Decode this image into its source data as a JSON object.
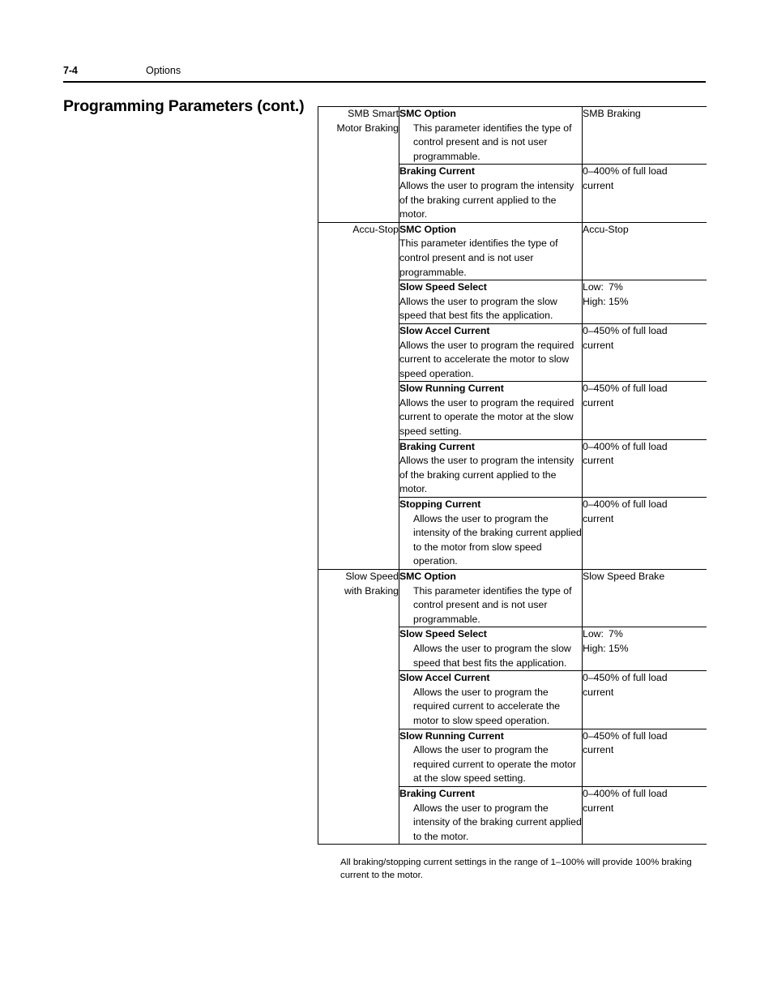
{
  "header": {
    "page_number": "7-4",
    "section": "Options"
  },
  "title": "Programming Parameters (cont.)",
  "footnote": "All braking/stopping current settings in the range of 1–100% will provide 100% braking current to the motor.",
  "table": {
    "groups": [
      {
        "label_lines": [
          "SMB Smart",
          "Motor Braking"
        ],
        "rows": [
          {
            "name": "SMC Option",
            "body": "This parameter identifies the type of control present and is not user programmable.",
            "indented": true,
            "value_lines": [
              "SMB Braking"
            ]
          },
          {
            "name": "Braking Current",
            "body": "Allows the user to program the intensity of the braking current applied to the motor.",
            "indented": false,
            "value_lines": [
              "0–400% of full load",
              "current"
            ]
          }
        ]
      },
      {
        "label_lines": [
          "Accu-Stop"
        ],
        "rows": [
          {
            "name": "SMC Option",
            "body": "This parameter identifies the type of control present and is not user programmable.",
            "indented": false,
            "value_lines": [
              "Accu-Stop"
            ]
          },
          {
            "name": "Slow Speed Select",
            "body": "Allows the user to program the slow speed that best fits the application.",
            "indented": false,
            "value_kv": [
              {
                "key": "Low:",
                "val": "7%"
              },
              {
                "key": "High:",
                "val": "15%"
              }
            ]
          },
          {
            "name": "Slow Accel Current",
            "body": "Allows the user to program the required current to accelerate the motor to slow speed operation.",
            "indented": false,
            "value_lines": [
              "0–450% of full load",
              "current"
            ]
          },
          {
            "name": "Slow Running Current",
            "body": "Allows the user to program the required current to operate the motor at the slow speed setting.",
            "indented": false,
            "value_lines": [
              "0–450% of full load",
              "current"
            ]
          },
          {
            "name": "Braking Current",
            "body": "Allows the user to program the intensity of the braking current applied to the motor.",
            "indented": false,
            "value_lines": [
              "0–400% of full load",
              "current"
            ]
          },
          {
            "name": "Stopping Current",
            "body": "Allows the user to program the intensity of the braking current applied to the motor from slow speed operation.",
            "indented": true,
            "value_lines": [
              "0–400% of full load",
              "current"
            ]
          }
        ]
      },
      {
        "label_lines": [
          "Slow Speed",
          "with Braking"
        ],
        "rows": [
          {
            "name": "SMC Option",
            "body": "This parameter identifies the type of control present and is not user programmable.",
            "indented": true,
            "value_lines": [
              "Slow Speed Brake"
            ]
          },
          {
            "name": "Slow Speed Select",
            "body": "Allows the user to program the slow speed that best fits the application.",
            "indented": true,
            "value_kv": [
              {
                "key": "Low:",
                "val": "7%"
              },
              {
                "key": "High:",
                "val": "15%"
              }
            ]
          },
          {
            "name": "Slow Accel Current",
            "body": "Allows the user to program the required current to accelerate the motor to slow speed operation.",
            "indented": true,
            "value_lines": [
              "0–450% of full load",
              "current"
            ]
          },
          {
            "name": "Slow Running Current",
            "body": "Allows the user to program the required current to operate the motor at the slow speed setting.",
            "indented": true,
            "value_lines": [
              "0–450% of full load",
              "current"
            ]
          },
          {
            "name": "Braking Current",
            "body": "Allows the user to program the intensity of the braking current applied to the motor.",
            "indented": true,
            "value_lines": [
              "0–400% of full load",
              "current"
            ]
          }
        ]
      }
    ]
  }
}
